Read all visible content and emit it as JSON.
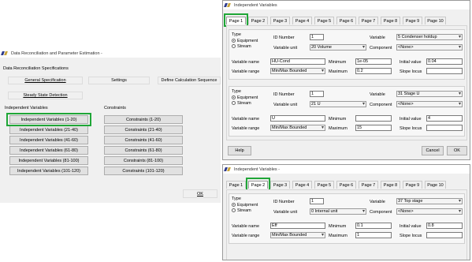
{
  "main_window": {
    "title": "Data Reconciliation and Parameter Estimation -",
    "heading": "Data Reconciliation Specifications",
    "general_spec": "General Specification",
    "settings": "Settings",
    "define_seq": "Define Calculation Sequence",
    "steady": "Steady State Detection",
    "indep_label": "Independent Variables",
    "constraints_label": "Constraints",
    "indep_buttons": [
      "Independent Variables (1-20)",
      "Independent Variables (21-40)",
      "Independent Variables (41-60)",
      "Independent Variables (61-80)",
      "Independent Variables (81-100)",
      "Independent Variables (101-120)"
    ],
    "constraint_buttons": [
      "Constraints (1-20)",
      "Constraints (21-40)",
      "Constraints (41-60)",
      "Constraints (61-80)",
      "Constraints (81-100)",
      "Constraints (101-120)"
    ],
    "ok": "OK"
  },
  "iv1": {
    "title": "Independent Variables",
    "tabs": [
      "Page 1",
      "Page 2",
      "Page 3",
      "Page 4",
      "Page 5",
      "Page 6",
      "Page 7",
      "Page 8",
      "Page 9",
      "Page 10"
    ],
    "help": "Help",
    "cancel": "Cancel",
    "ok": "OK",
    "labels": {
      "type": "Type",
      "equipment": "Equipment",
      "stream": "Stream",
      "id_number": "ID Number",
      "variable_unit": "Variable unit",
      "variable": "Variable",
      "component": "Component",
      "variable_name": "Variable name",
      "minimum": "Minimum",
      "initial_value": "Initial value",
      "variable_range": "Variable range",
      "maximum": "Maximum",
      "slope_locus": "Slope locus"
    },
    "rows": [
      {
        "id": "1",
        "unit": "20 Volume",
        "variable": "5 Condenser holdup",
        "component": "<None>",
        "name": "HU-Cond",
        "minimum": "1e-05",
        "initial": "0.04",
        "range": "Min/Max Bounded",
        "maximum": "0.2",
        "slope": ""
      },
      {
        "id": "1",
        "unit": "21 U",
        "variable": "31 Stage U",
        "component": "<None>",
        "name": "U",
        "minimum": "",
        "initial": "4",
        "range": "Min/Max Bounded",
        "maximum": "15",
        "slope": ""
      }
    ]
  },
  "iv2": {
    "title": "Independent Variables -",
    "tabs": [
      "Page 1",
      "Page 2",
      "Page 3",
      "Page 4",
      "Page 5",
      "Page 6",
      "Page 7",
      "Page 8",
      "Page 9",
      "Page 10"
    ],
    "row": {
      "id": "1",
      "unit": "0 Internal unit",
      "variable": "37 Top stage",
      "component": "<None>",
      "name": "Eff",
      "minimum": "0.1",
      "initial": "0.8",
      "range": "Min/Max Bounded",
      "maximum": "1",
      "slope": ""
    }
  },
  "colors": {
    "highlight": "#1fa637"
  }
}
